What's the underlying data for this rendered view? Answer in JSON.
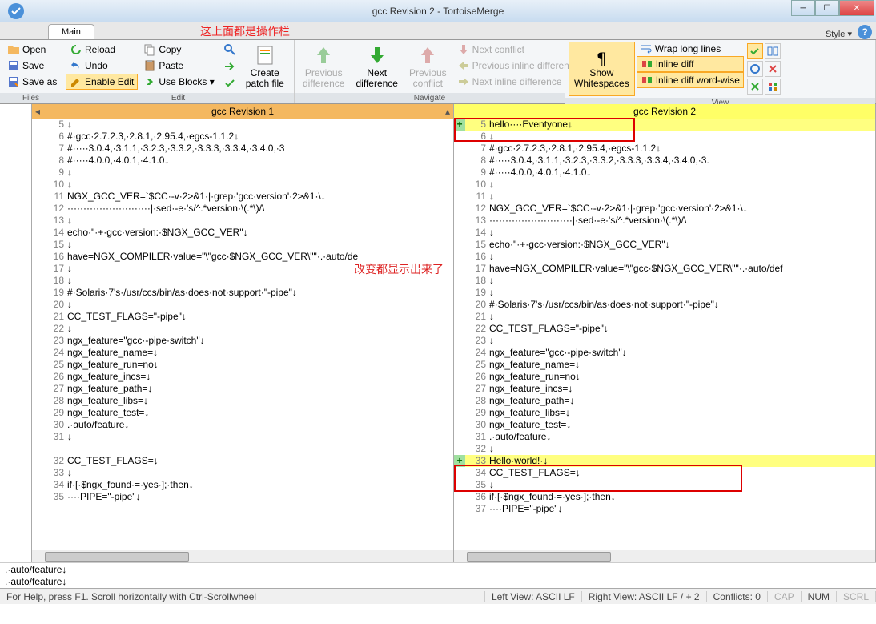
{
  "window": {
    "title": "gcc Revision 2 - TortoiseMerge",
    "main_tab": "Main",
    "style_label": "Style ▾",
    "annotations": {
      "toolbar": "这上面都是操作栏",
      "changes": "改变都显示出来了"
    }
  },
  "ribbon": {
    "files": {
      "label": "Files",
      "open": "Open",
      "save": "Save",
      "save_as": "Save as",
      "reload": "Reload",
      "undo": "Undo",
      "enable_edit": "Enable Edit"
    },
    "edit": {
      "label": "Edit",
      "copy": "Copy",
      "paste": "Paste",
      "use_blocks": "Use Blocks ▾",
      "create_patch": "Create\npatch file"
    },
    "navigate": {
      "label": "Navigate",
      "prev_diff": "Previous\ndifference",
      "next_diff": "Next\ndifference",
      "prev_conflict": "Previous\nconflict",
      "next_conflict": "Next conflict",
      "prev_inline": "Previous inline difference",
      "next_inline": "Next inline difference"
    },
    "view": {
      "label": "View",
      "show_ws": "Show\nWhitespaces",
      "wrap": "Wrap long lines",
      "inline_diff": "Inline diff",
      "inline_diff_ww": "Inline diff word-wise"
    }
  },
  "panes": {
    "left_title": "gcc Revision 1",
    "right_title": "gcc Revision 2",
    "left_lines": [
      {
        "n": 5,
        "t": "↓"
      },
      {
        "n": 6,
        "t": "#·gcc·2.7.2.3,·2.8.1,·2.95.4,·egcs-1.1.2↓"
      },
      {
        "n": 7,
        "t": "#·····3.0.4,·3.1.1,·3.2.3,·3.3.2,·3.3.3,·3.3.4,·3.4.0,·3"
      },
      {
        "n": 8,
        "t": "#·····4.0.0,·4.0.1,·4.1.0↓"
      },
      {
        "n": 9,
        "t": "↓"
      },
      {
        "n": 10,
        "t": "↓"
      },
      {
        "n": 11,
        "t": "NGX_GCC_VER=`$CC·-v·2>&1·|·grep·'gcc·version'·2>&1·\\↓"
      },
      {
        "n": 12,
        "t": "··························|·sed·-e·'s/^.*version·\\(.*\\)/\\"
      },
      {
        "n": 13,
        "t": "↓"
      },
      {
        "n": 14,
        "t": "echo·\"·+·gcc·version:·$NGX_GCC_VER\"↓"
      },
      {
        "n": 15,
        "t": "↓"
      },
      {
        "n": 16,
        "t": "have=NGX_COMPILER·value=\"\\\"gcc·$NGX_GCC_VER\\\"\"·.·auto/de"
      },
      {
        "n": 17,
        "t": "↓"
      },
      {
        "n": 18,
        "t": "↓"
      },
      {
        "n": 19,
        "t": "#·Solaris·7's·/usr/ccs/bin/as·does·not·support·\"-pipe\"↓"
      },
      {
        "n": 20,
        "t": "↓"
      },
      {
        "n": 21,
        "t": "CC_TEST_FLAGS=\"-pipe\"↓"
      },
      {
        "n": 22,
        "t": "↓"
      },
      {
        "n": 23,
        "t": "ngx_feature=\"gcc·-pipe·switch\"↓"
      },
      {
        "n": 24,
        "t": "ngx_feature_name=↓"
      },
      {
        "n": 25,
        "t": "ngx_feature_run=no↓"
      },
      {
        "n": 26,
        "t": "ngx_feature_incs=↓"
      },
      {
        "n": 27,
        "t": "ngx_feature_path=↓"
      },
      {
        "n": 28,
        "t": "ngx_feature_libs=↓"
      },
      {
        "n": 29,
        "t": "ngx_feature_test=↓"
      },
      {
        "n": 30,
        "t": ".·auto/feature↓"
      },
      {
        "n": 31,
        "t": "↓"
      },
      {
        "n": "",
        "t": ""
      },
      {
        "n": 32,
        "t": "CC_TEST_FLAGS=↓"
      },
      {
        "n": 33,
        "t": "↓"
      },
      {
        "n": 34,
        "t": "if·[·$ngx_found·=·yes·];·then↓"
      },
      {
        "n": 35,
        "t": "····PIPE=\"-pipe\"↓"
      }
    ],
    "right_lines": [
      {
        "n": 5,
        "t": "hello····Eventyone↓",
        "cls": "added",
        "mark": "+"
      },
      {
        "n": 6,
        "t": "↓"
      },
      {
        "n": 7,
        "t": "#·gcc·2.7.2.3,·2.8.1,·2.95.4,·egcs-1.1.2↓"
      },
      {
        "n": 8,
        "t": "#·····3.0.4,·3.1.1,·3.2.3,·3.3.2,·3.3.3,·3.3.4,·3.4.0,·3."
      },
      {
        "n": 9,
        "t": "#·····4.0.0,·4.0.1,·4.1.0↓"
      },
      {
        "n": 10,
        "t": "↓"
      },
      {
        "n": 11,
        "t": "↓"
      },
      {
        "n": 12,
        "t": "NGX_GCC_VER=`$CC·-v·2>&1·|·grep·'gcc·version'·2>&1·\\↓"
      },
      {
        "n": 13,
        "t": "··························|·sed·-e·'s/^.*version·\\(.*\\)/\\"
      },
      {
        "n": 14,
        "t": "↓"
      },
      {
        "n": 15,
        "t": "echo·\"·+·gcc·version:·$NGX_GCC_VER\"↓"
      },
      {
        "n": 16,
        "t": "↓"
      },
      {
        "n": 17,
        "t": "have=NGX_COMPILER·value=\"\\\"gcc·$NGX_GCC_VER\\\"\"·.·auto/def"
      },
      {
        "n": 18,
        "t": "↓"
      },
      {
        "n": 19,
        "t": "↓"
      },
      {
        "n": 20,
        "t": "#·Solaris·7's·/usr/ccs/bin/as·does·not·support·\"-pipe\"↓"
      },
      {
        "n": 21,
        "t": "↓"
      },
      {
        "n": 22,
        "t": "CC_TEST_FLAGS=\"-pipe\"↓"
      },
      {
        "n": 23,
        "t": "↓"
      },
      {
        "n": 24,
        "t": "ngx_feature=\"gcc·-pipe·switch\"↓"
      },
      {
        "n": 25,
        "t": "ngx_feature_name=↓"
      },
      {
        "n": 26,
        "t": "ngx_feature_run=no↓"
      },
      {
        "n": 27,
        "t": "ngx_feature_incs=↓"
      },
      {
        "n": 28,
        "t": "ngx_feature_path=↓"
      },
      {
        "n": 29,
        "t": "ngx_feature_libs=↓"
      },
      {
        "n": 30,
        "t": "ngx_feature_test=↓"
      },
      {
        "n": 31,
        "t": ".·auto/feature↓"
      },
      {
        "n": 32,
        "t": "↓"
      },
      {
        "n": 33,
        "t": "Hello·world!·↓",
        "cls": "added",
        "mark": "+"
      },
      {
        "n": 34,
        "t": "CC_TEST_FLAGS=↓"
      },
      {
        "n": 35,
        "t": "↓"
      },
      {
        "n": 36,
        "t": "if·[·$ngx_found·=·yes·];·then↓"
      },
      {
        "n": 37,
        "t": "····PIPE=\"-pipe\"↓"
      }
    ]
  },
  "bottom_info": {
    "l1": ".·auto/feature↓",
    "l2": ".·auto/feature↓"
  },
  "status": {
    "help": "For Help, press F1. Scroll horizontally with Ctrl-Scrollwheel",
    "left_view": "Left View: ASCII LF",
    "right_view": "Right View: ASCII LF  / + 2",
    "conflicts": "Conflicts: 0",
    "cap": "CAP",
    "num": "NUM",
    "scrl": "SCRL"
  }
}
